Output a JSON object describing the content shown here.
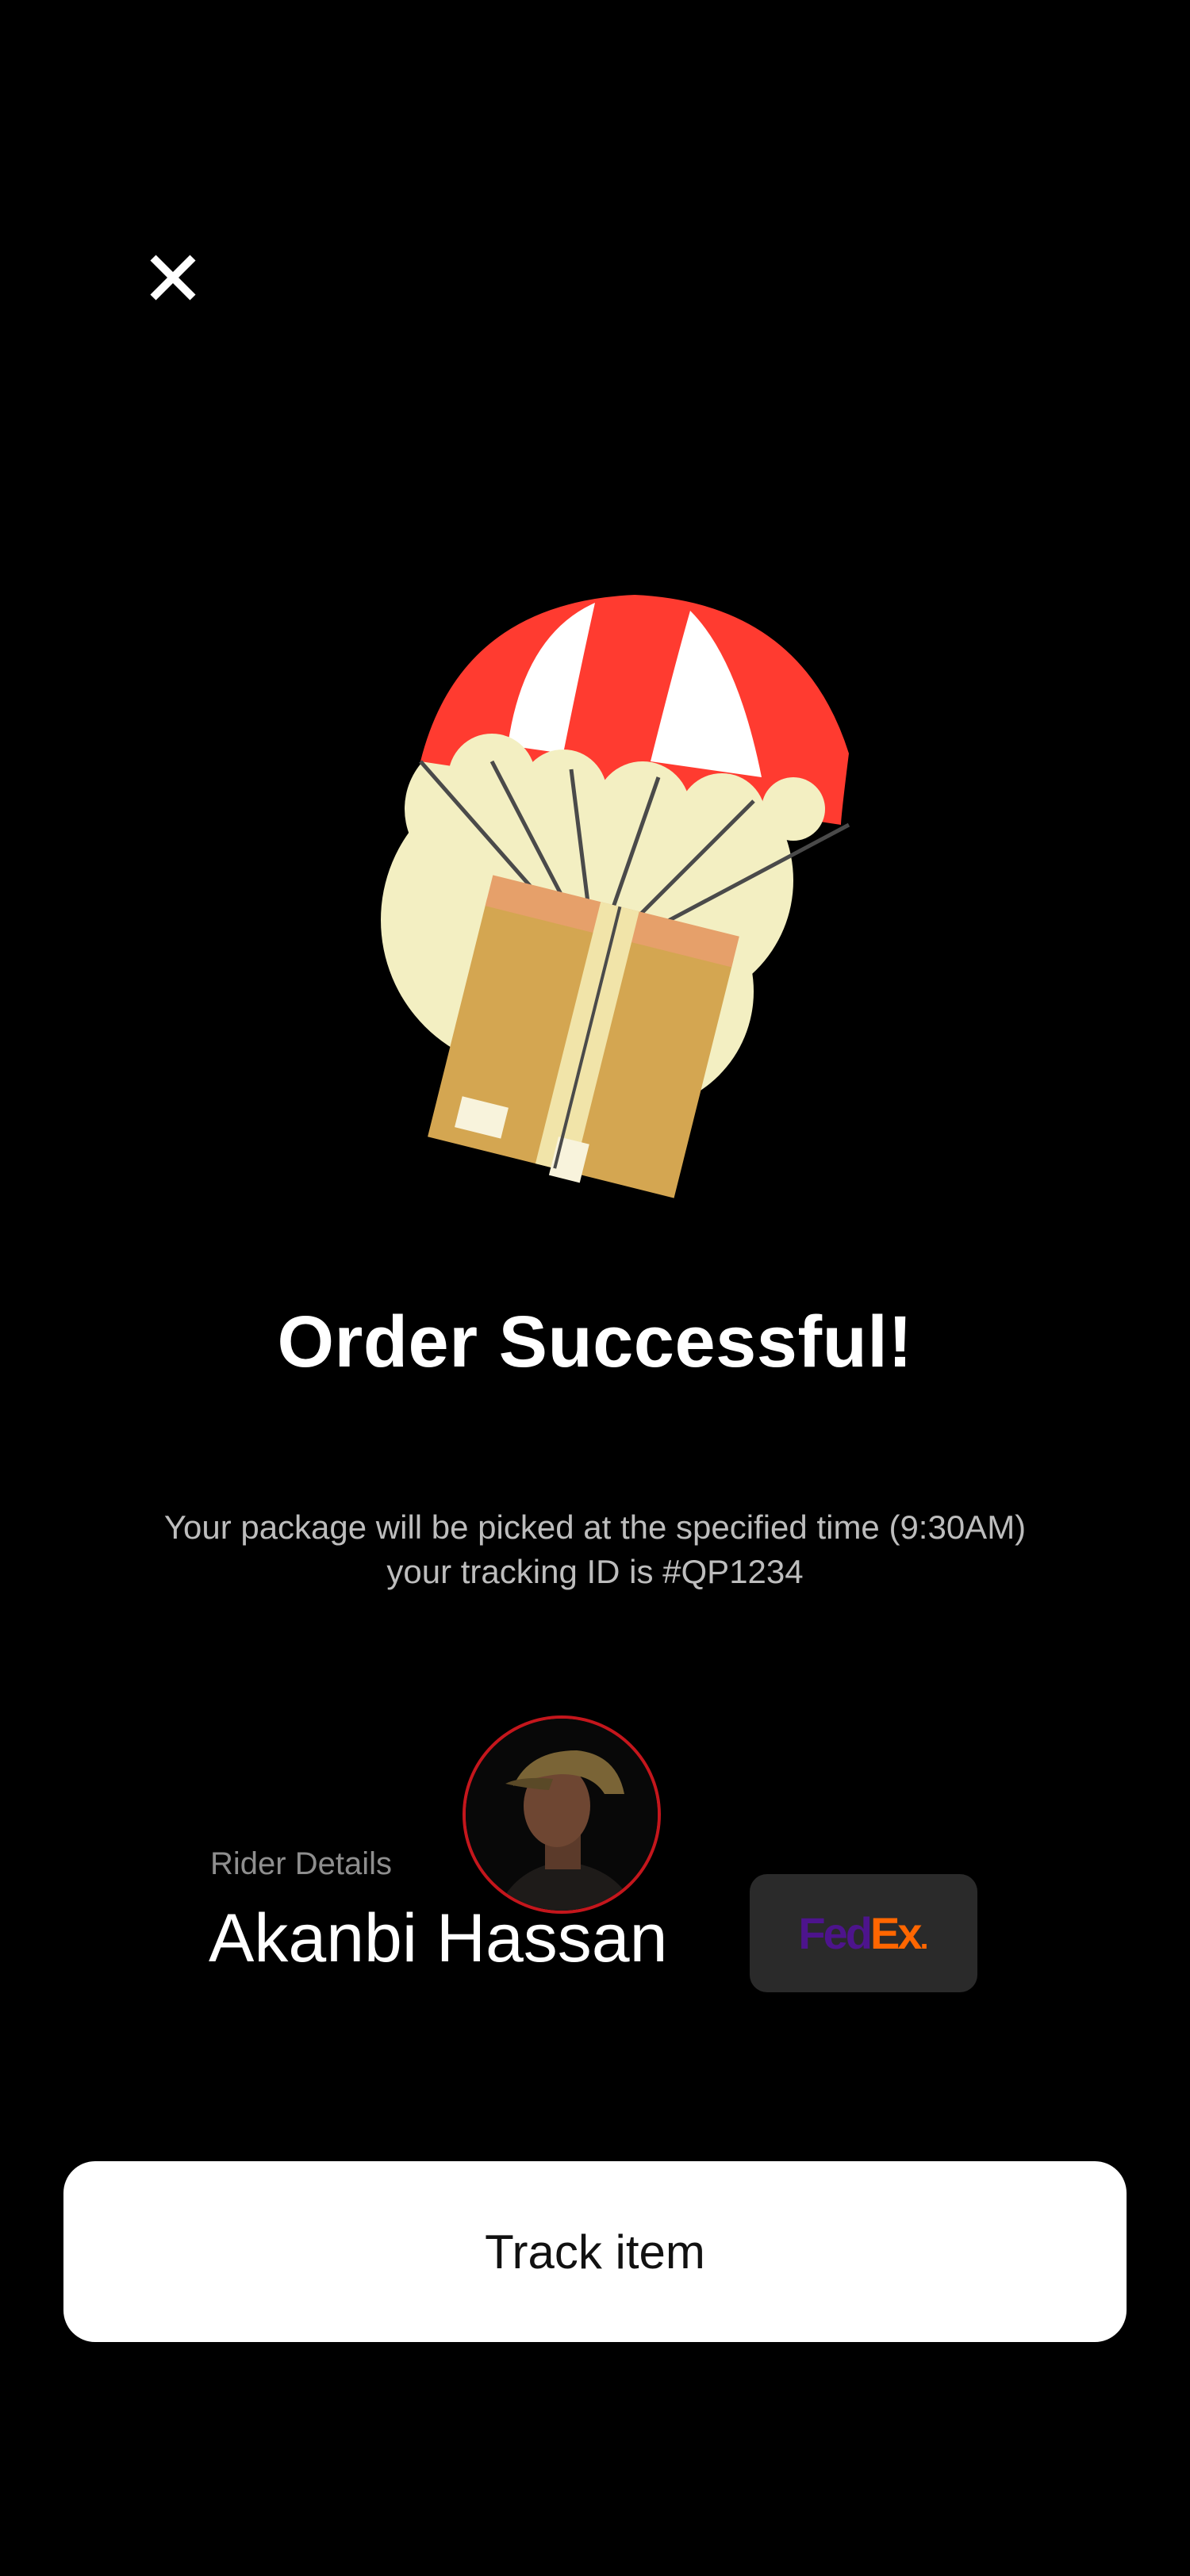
{
  "icons": {
    "close": "close-icon",
    "hero": "parachute-package-illustration"
  },
  "colors": {
    "background": "#000000",
    "title": "#ffffff",
    "subtitle": "#bdbdbd",
    "avatar_ring": "#c4161c",
    "button_bg": "#ffffff",
    "button_text": "#111111",
    "badge_bg": "#2a2a2a",
    "fedex_purple": "#4d148c",
    "fedex_orange": "#ff6600"
  },
  "screen": {
    "title": "Order Successful!",
    "message_line1": "Your package will be picked at the specified time (9:30AM)",
    "message_line2": "your tracking ID is #QP1234"
  },
  "rider": {
    "label": "Rider Details",
    "name": "Akanbi Hassan",
    "carrier_part1": "Fed",
    "carrier_part2": "Ex",
    "carrier_dot": "."
  },
  "actions": {
    "track_label": "Track item"
  }
}
